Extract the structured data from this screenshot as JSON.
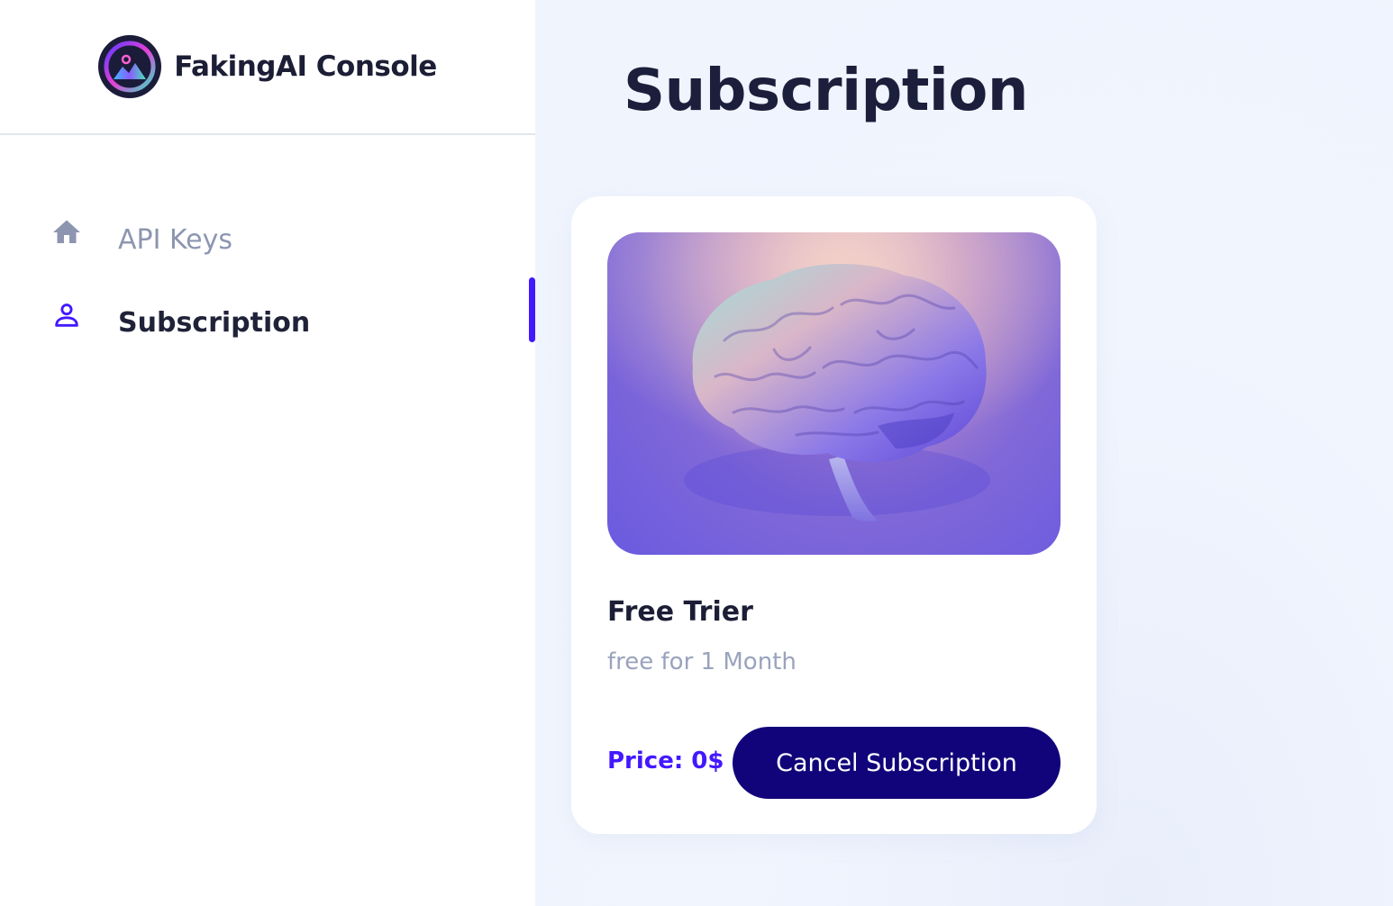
{
  "app": {
    "brand_name": "FakingAI Console",
    "logo_icon": "logo-icon"
  },
  "sidebar": {
    "items": [
      {
        "label": "API Keys",
        "icon": "home-icon",
        "active": false
      },
      {
        "label": "Subscription",
        "icon": "person-icon",
        "active": true
      }
    ]
  },
  "main": {
    "title": "Subscription",
    "card": {
      "image_icon": "brain-image",
      "plan_name": "Free Trier",
      "plan_desc": "free for 1 Month",
      "price": "Price: 0$",
      "cancel_label": "Cancel Subscription"
    }
  },
  "colors": {
    "accent": "#4318ff",
    "button": "#11047a",
    "heading": "#1b1f3b",
    "muted": "#8d96b0",
    "background": "#f0f4fd"
  }
}
